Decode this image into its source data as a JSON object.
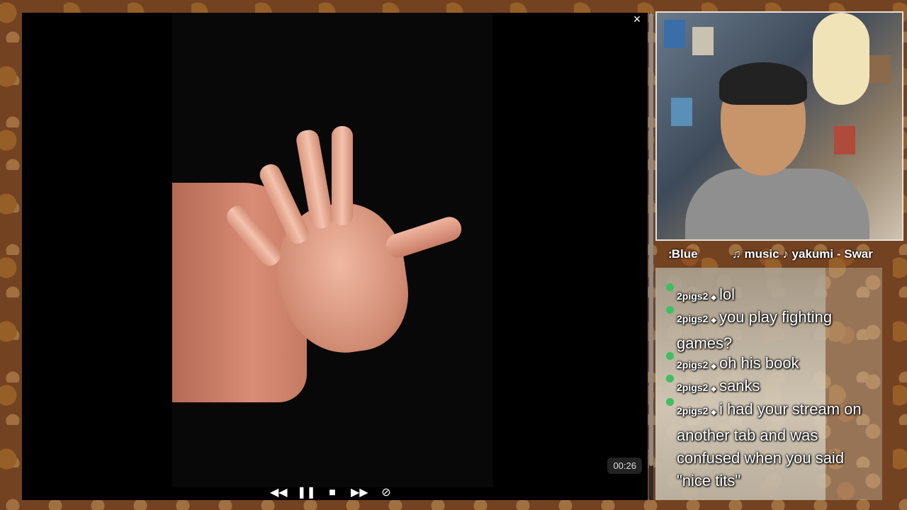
{
  "viewer": {
    "close_label": "×",
    "timestamp": "00:26",
    "controls": {
      "rewind": "◀◀",
      "pause": "❚❚",
      "stop": "■",
      "forward": "▶▶",
      "hide": "⊘"
    }
  },
  "now_playing": {
    "left_label": "׃ Blue",
    "music_label": "♫ music ♪ yakumi - Swar"
  },
  "chat": {
    "messages": [
      {
        "user": "2pigs2",
        "text": "lol"
      },
      {
        "user": "2pigs2",
        "text": "you play fighting games?"
      },
      {
        "user": "2pigs2",
        "text": "oh his book"
      },
      {
        "user": "2pigs2",
        "text": "sanks"
      },
      {
        "user": "2pigs2",
        "text": "i had your stream on another tab and was confused when you said \"nice tits\""
      }
    ]
  },
  "icons": {
    "close": "close-icon",
    "rewind": "rewind-icon",
    "pause": "pause-icon",
    "stop": "stop-icon",
    "forward": "fast-forward-icon",
    "hide": "eye-off-icon",
    "badge": "subscriber-badge-icon"
  },
  "colors": {
    "viewer_bg": "#000000",
    "badge": "#3fbf5f",
    "chat_text": "#ffffff"
  }
}
